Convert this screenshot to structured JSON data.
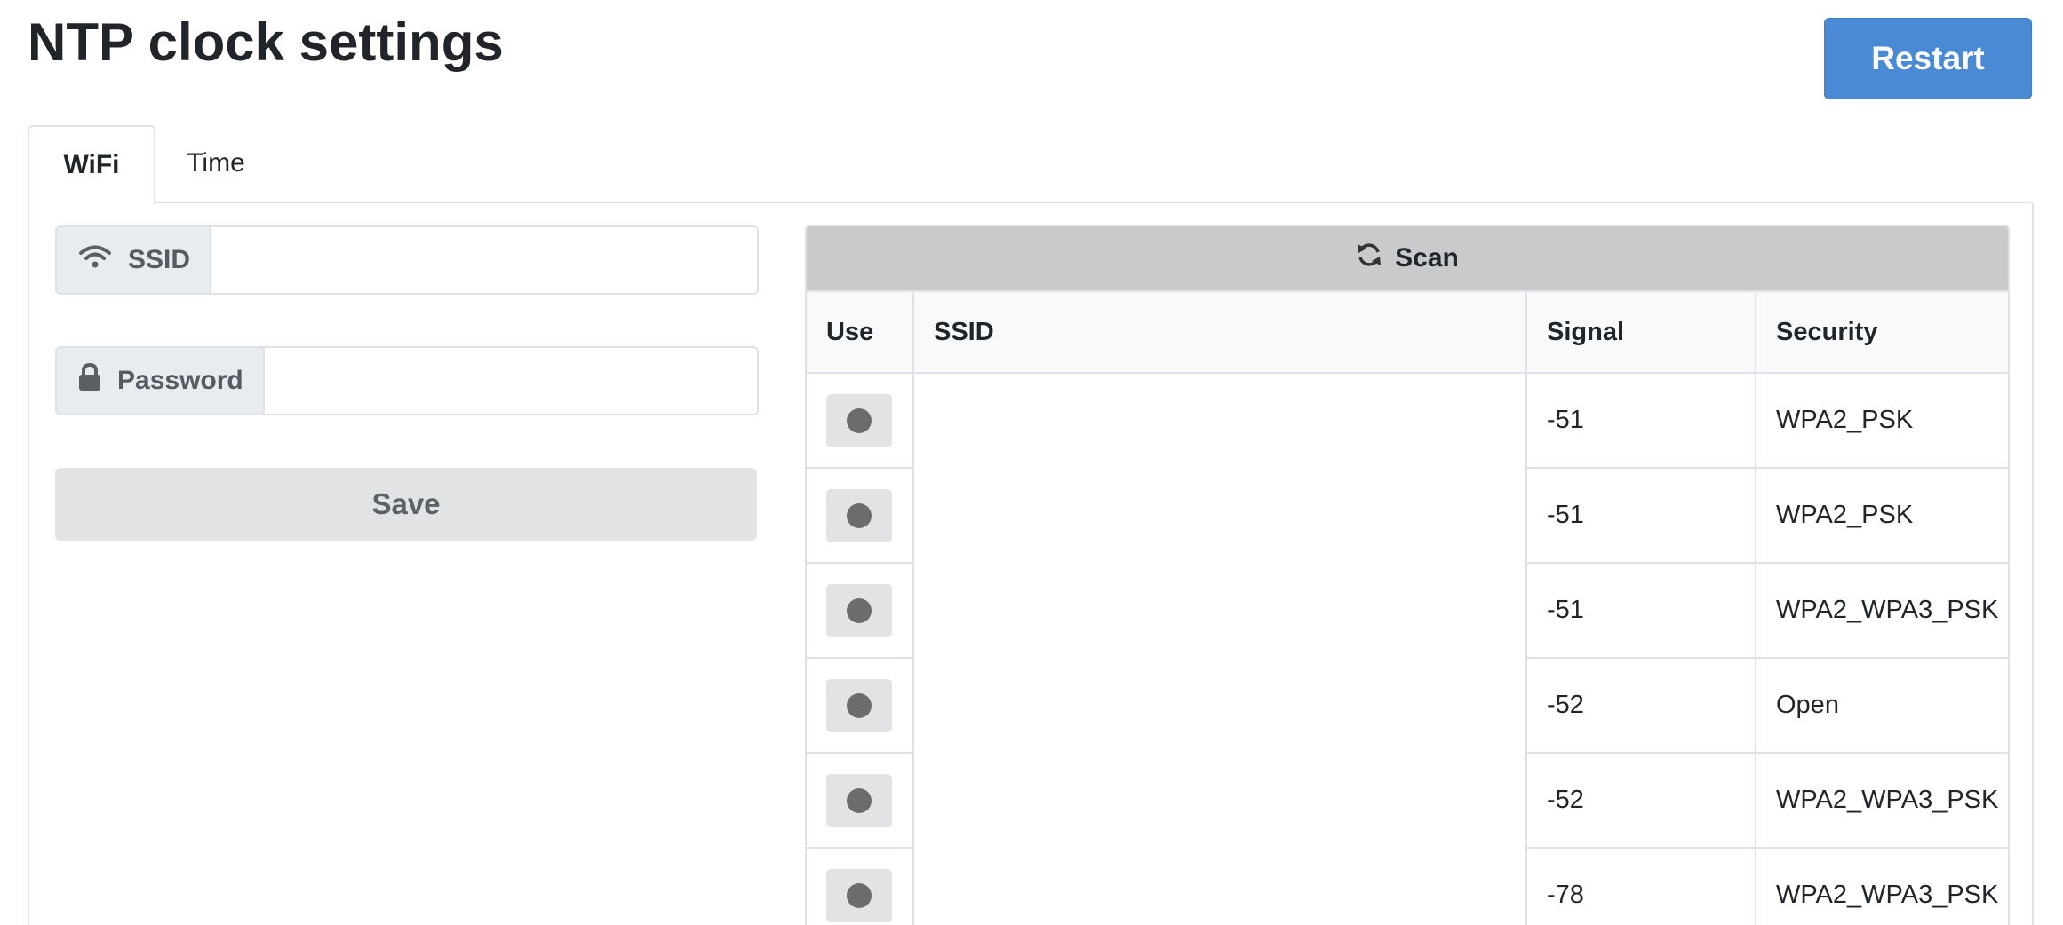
{
  "header": {
    "title": "NTP clock settings",
    "restart_label": "Restart"
  },
  "tabs": [
    {
      "label": "WiFi",
      "active": true
    },
    {
      "label": "Time",
      "active": false
    }
  ],
  "wifi_form": {
    "ssid_label": "SSID",
    "ssid_value": "",
    "password_label": "Password",
    "password_value": "",
    "save_label": "Save",
    "icons": {
      "ssid": "wifi-icon",
      "password": "lock-icon"
    }
  },
  "networks": {
    "scan_label": "Scan",
    "scan_icon": "refresh-icon",
    "columns": [
      "Use",
      "SSID",
      "Signal",
      "Security"
    ],
    "rows": [
      {
        "ssid": "",
        "signal": "-51",
        "security": "WPA2_PSK"
      },
      {
        "ssid": "",
        "signal": "-51",
        "security": "WPA2_PSK"
      },
      {
        "ssid": "",
        "signal": "-51",
        "security": "WPA2_WPA3_PSK"
      },
      {
        "ssid": "",
        "signal": "-52",
        "security": "Open"
      },
      {
        "ssid": "",
        "signal": "-52",
        "security": "WPA2_WPA3_PSK"
      },
      {
        "ssid": "",
        "signal": "-78",
        "security": "WPA2_WPA3_PSK"
      }
    ]
  },
  "colors": {
    "primary": "#4a89d4",
    "scan_bar": "#c9cacc",
    "secondary_button": "#e2e3e5",
    "border": "#dee2e6"
  }
}
